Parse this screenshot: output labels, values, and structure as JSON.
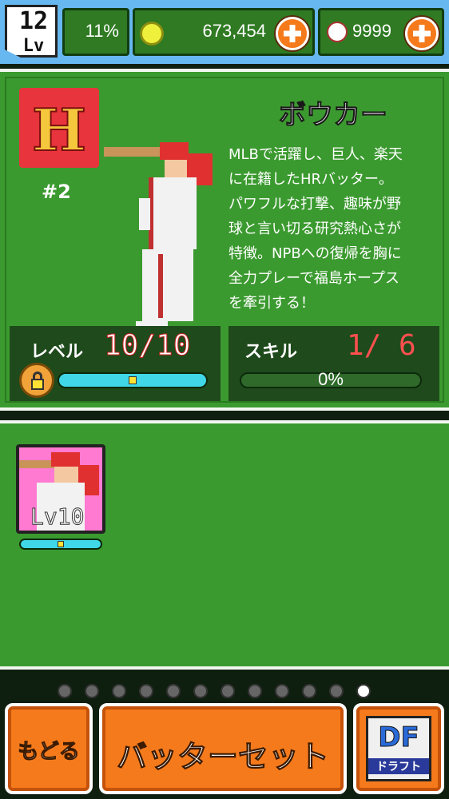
{
  "status_bar": {
    "level_number": "12",
    "level_label": "Lv",
    "exp_percent": "11%",
    "coins": "673,454",
    "balls": "9999"
  },
  "player": {
    "team_logo_letter": "H",
    "number": "#2",
    "name": "ボウカー",
    "bio_lines": [
      "MLBで活躍し、巨人、楽天",
      "に在籍したHRバッター。",
      "パワフルな打撃、趣味が野",
      "球と言い切る研究熱心さが",
      "特徴。NPBへの復帰を胸に",
      "全力プレーで福島ホープス",
      "を牽引する！"
    ],
    "level_label": "レベル",
    "level_value": "10/10",
    "level_progress": 1.0,
    "skill_label": "スキル",
    "skill_value": "1/ 6",
    "skill_percent_label": "0%",
    "skill_progress": 0.0
  },
  "collection": {
    "cards": [
      {
        "level_label": "Lv10",
        "progress": 1.0
      }
    ]
  },
  "pager": {
    "total": 12,
    "active_index": 11
  },
  "buttons": {
    "back": "もどる",
    "set_batter": "バッターセット",
    "draft_icon_big": "DF",
    "draft_icon_small": "ドラフト"
  },
  "colors": {
    "accent_orange": "#f57a1c",
    "panel_green": "#3b9a2f",
    "bar_cyan": "#40d8e8",
    "card_pink": "#ff7ad0"
  }
}
